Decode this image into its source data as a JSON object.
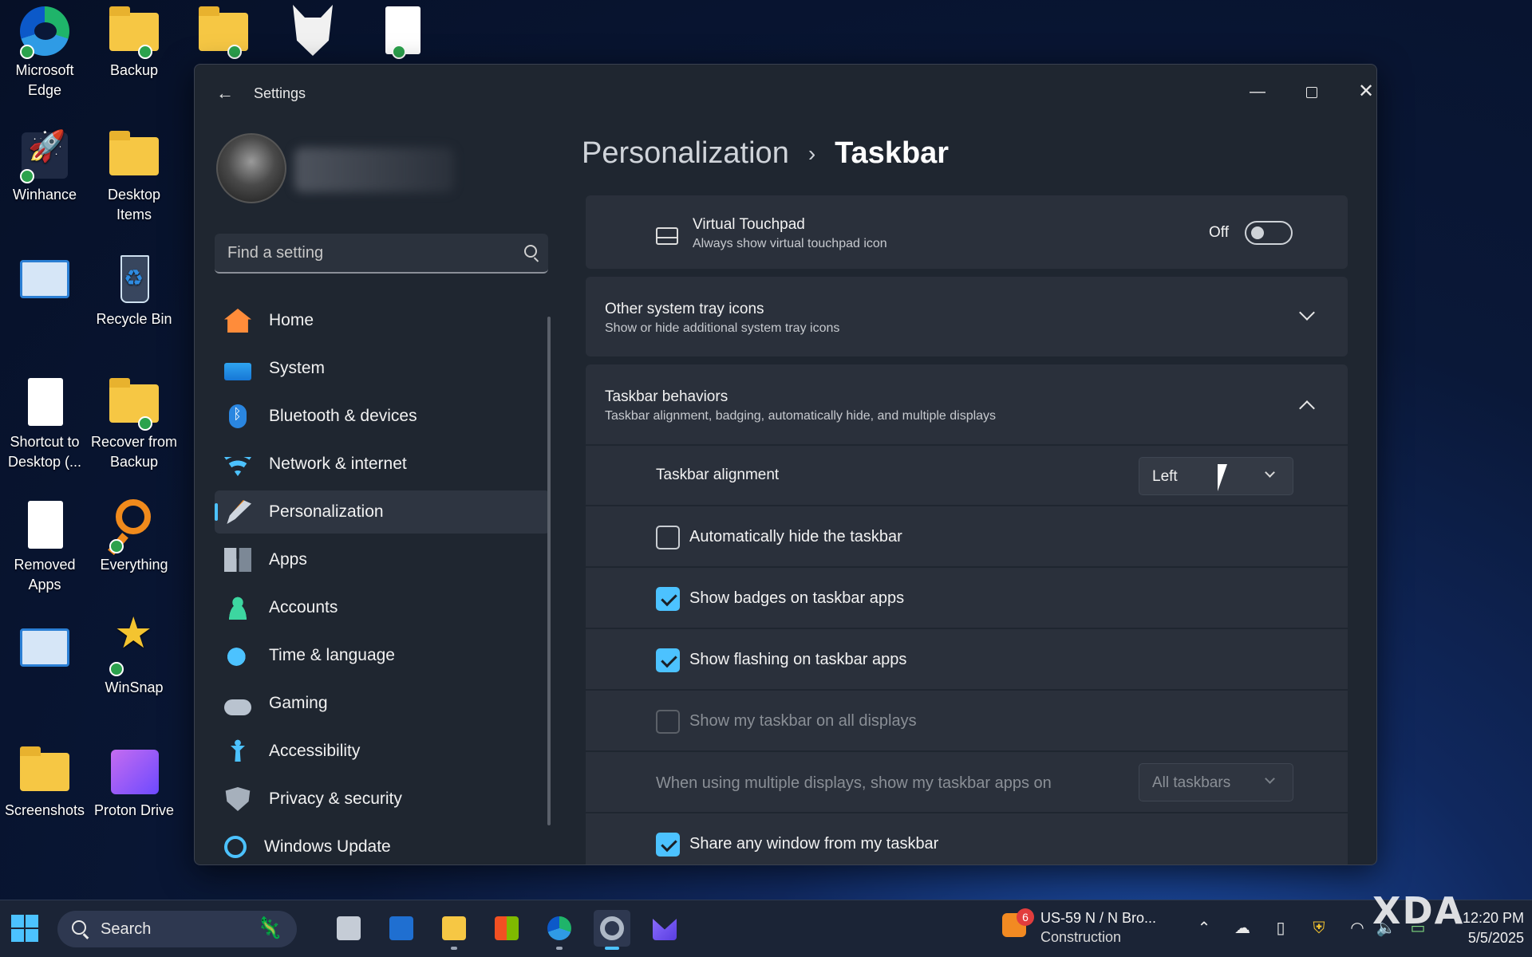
{
  "desktop": {
    "icons": [
      {
        "label": "Microsoft Edge",
        "icon": "edge-icon"
      },
      {
        "label": "Backup",
        "icon": "folder-icon"
      },
      {
        "label": "Winhance",
        "icon": "rocket-icon"
      },
      {
        "label": "Desktop Items",
        "icon": "folder-icon"
      },
      {
        "label": "Recycle Bin",
        "icon": "recycle-bin-icon"
      },
      {
        "label": "Shortcut to Desktop (...",
        "icon": "file-icon"
      },
      {
        "label": "Recover from Backup",
        "icon": "folder-icon"
      },
      {
        "label": "Removed Apps",
        "icon": "file-icon"
      },
      {
        "label": "Everything",
        "icon": "search-app-icon"
      },
      {
        "label": "WinSnap",
        "icon": "winsnap-icon"
      },
      {
        "label": "Screenshots",
        "icon": "folder-icon"
      },
      {
        "label": "Proton Drive",
        "icon": "proton-drive-icon"
      }
    ]
  },
  "window": {
    "title": "Settings",
    "back_icon": "back-arrow-icon",
    "minimize_icon": "minimize-icon",
    "maximize_icon": "maximize-icon",
    "close_icon": "close-icon"
  },
  "sidebar": {
    "search_placeholder": "Find a setting",
    "items": [
      {
        "label": "Home",
        "icon": "home-icon",
        "active": false
      },
      {
        "label": "System",
        "icon": "system-icon",
        "active": false
      },
      {
        "label": "Bluetooth & devices",
        "icon": "bluetooth-icon",
        "active": false
      },
      {
        "label": "Network & internet",
        "icon": "wifi-icon",
        "active": false
      },
      {
        "label": "Personalization",
        "icon": "brush-icon",
        "active": true
      },
      {
        "label": "Apps",
        "icon": "apps-icon",
        "active": false
      },
      {
        "label": "Accounts",
        "icon": "accounts-icon",
        "active": false
      },
      {
        "label": "Time & language",
        "icon": "globe-clock-icon",
        "active": false
      },
      {
        "label": "Gaming",
        "icon": "gamepad-icon",
        "active": false
      },
      {
        "label": "Accessibility",
        "icon": "accessibility-icon",
        "active": false
      },
      {
        "label": "Privacy & security",
        "icon": "shield-icon",
        "active": false
      },
      {
        "label": "Windows Update",
        "icon": "update-icon",
        "active": false
      }
    ]
  },
  "breadcrumb": {
    "parent": "Personalization",
    "separator": "›",
    "current": "Taskbar"
  },
  "main": {
    "virtual_touchpad": {
      "title": "Virtual Touchpad",
      "subtitle": "Always show virtual touchpad icon",
      "state_label": "Off",
      "on": false
    },
    "other_tray": {
      "title": "Other system tray icons",
      "subtitle": "Show or hide additional system tray icons"
    },
    "behaviors": {
      "title": "Taskbar behaviors",
      "subtitle": "Taskbar alignment, badging, automatically hide, and multiple displays",
      "alignment_label": "Taskbar alignment",
      "alignment_value": "Left",
      "options": [
        {
          "label": "Automatically hide the taskbar",
          "checked": false,
          "disabled": false
        },
        {
          "label": "Show badges on taskbar apps",
          "checked": true,
          "disabled": false
        },
        {
          "label": "Show flashing on taskbar apps",
          "checked": true,
          "disabled": false
        },
        {
          "label": "Show my taskbar on all displays",
          "checked": false,
          "disabled": true
        }
      ],
      "multi_display_label": "When using multiple displays, show my taskbar apps on",
      "multi_display_value": "All taskbars",
      "share_window_label": "Share any window from my taskbar",
      "share_window_checked": true
    }
  },
  "taskbar": {
    "search_label": "Search",
    "apps": [
      "task-view-icon",
      "outlook-icon",
      "file-explorer-icon",
      "store-icon",
      "edge-icon",
      "settings-icon",
      "proton-mail-icon"
    ],
    "weather": {
      "badge": "6",
      "line1": "US-59 N / N Bro...",
      "line2": "Construction"
    },
    "clock": {
      "time": "12:20 PM",
      "date": "5/5/2025"
    },
    "watermark": "XDA"
  },
  "colors": {
    "accent": "#4cc2ff",
    "window_bg": "#1f2630",
    "card_bg": "#2a303b"
  }
}
